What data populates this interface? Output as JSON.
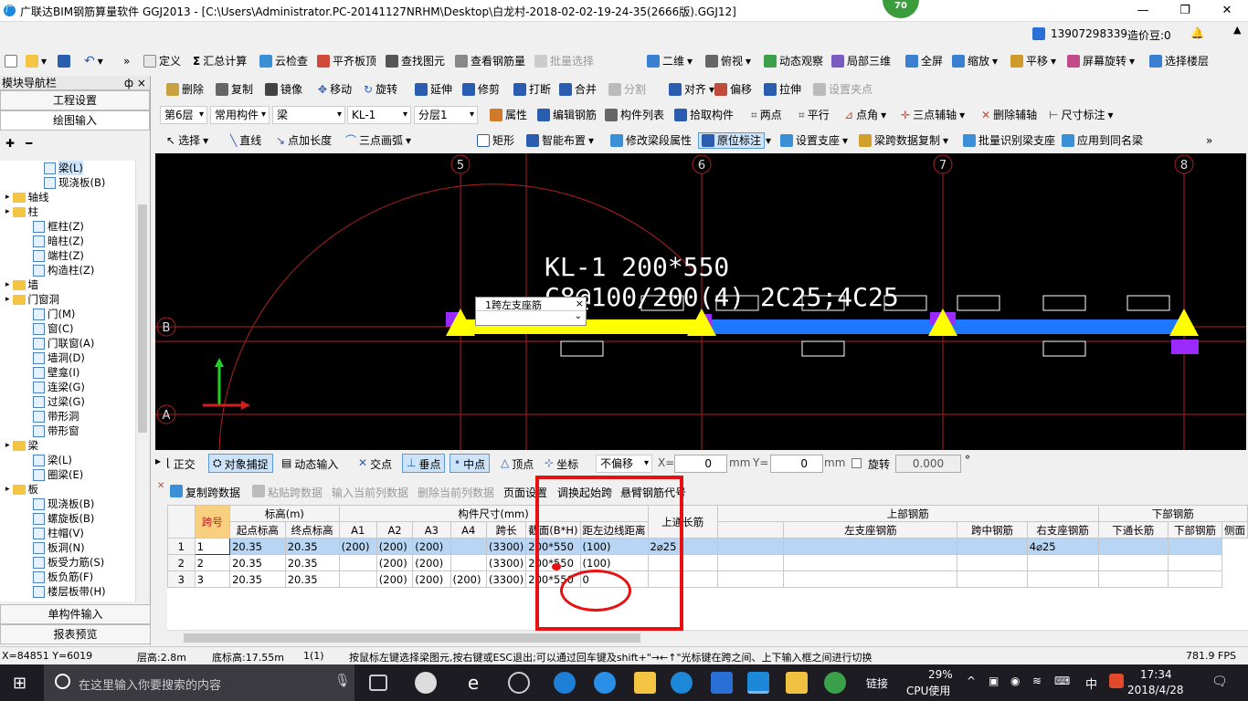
{
  "window": {
    "title": "广联达BIM钢筋算量软件 GGJ2013 - [C:\\Users\\Administrator.PC-20141127NRHM\\Desktop\\白龙村-2018-02-02-19-24-35(2666版).GGJ12]",
    "badge": "70"
  },
  "userbar": {
    "phone": "13907298339",
    "coins": "造价豆:0"
  },
  "toolbar1": {
    "items": [
      "定义",
      "汇总计算",
      "云检查",
      "平齐板顶",
      "查找图元",
      "查看钢筋量",
      "批量选择",
      "二维",
      "俯视",
      "动态观察",
      "局部三维",
      "全屏",
      "缩放",
      "平移",
      "屏幕旋转",
      "选择楼层"
    ]
  },
  "toolbar2": {
    "items": [
      "删除",
      "复制",
      "镜像",
      "移动",
      "旋转",
      "延伸",
      "修剪",
      "打断",
      "合并",
      "分割",
      "对齐",
      "偏移",
      "拉伸",
      "设置夹点"
    ]
  },
  "toolbar3": {
    "floor": "第6层",
    "category": "常用构件",
    "type": "梁",
    "name": "KL-1",
    "layer": "分层1",
    "items": [
      "属性",
      "编辑钢筋",
      "构件列表",
      "拾取构件",
      "两点",
      "平行",
      "点角",
      "三点辅轴",
      "删除辅轴",
      "尺寸标注"
    ]
  },
  "toolbar4": {
    "items": [
      "选择",
      "直线",
      "点加长度",
      "三点画弧",
      "矩形",
      "智能布置",
      "修改梁段属性",
      "原位标注",
      "设置支座",
      "梁跨数据复制",
      "批量识别梁支座",
      "应用到同名梁"
    ]
  },
  "nav": {
    "title": "模块导航栏",
    "pin": "ф ×",
    "btn_project": "工程设置",
    "btn_draw": "绘图输入",
    "btn_single": "单构件输入",
    "btn_report": "报表预览",
    "tree": [
      "梁(L)",
      "现浇板(B)",
      "轴线",
      "柱",
      "框柱(Z)",
      "暗柱(Z)",
      "端柱(Z)",
      "构造柱(Z)",
      "墙",
      "门窗洞",
      "门(M)",
      "窗(C)",
      "门联窗(A)",
      "墙洞(D)",
      "壁龛(I)",
      "连梁(G)",
      "过梁(G)",
      "带形洞",
      "带形窗",
      "梁",
      "梁(L)",
      "圈梁(E)",
      "板",
      "现浇板(B)",
      "螺旋板(B)",
      "柱帽(V)",
      "板洞(N)",
      "板受力筋(S)",
      "板负筋(F)",
      "楼层板带(H)"
    ]
  },
  "canvas": {
    "axes": [
      "5",
      "6",
      "7",
      "8"
    ],
    "rows": [
      "B",
      "A"
    ],
    "label1": "KL-1 200*550",
    "label2": "C8@100/200(4) 2C25;4C25",
    "popup": "1跨左支座筋",
    "popup_close": "×"
  },
  "snapbar": {
    "items": [
      "正交",
      "对象捕捉",
      "动态输入",
      "交点",
      "垂点",
      "中点",
      "顶点",
      "坐标",
      "不偏移"
    ],
    "x_label": "X=",
    "x_val": "0",
    "mm1": "mm",
    "y_label": "Y=",
    "y_val": "0",
    "mm2": "mm",
    "rotate": "旋转",
    "rot_val": "0.000",
    "deg": "°"
  },
  "tblbar": {
    "items": [
      "复制跨数据",
      "粘贴跨数据",
      "输入当前列数据",
      "删除当前列数据",
      "页面设置",
      "调换起始跨",
      "悬臂钢筋代号"
    ]
  },
  "grid": {
    "group1": [
      "跨号",
      "标高(m)",
      "构件尺寸(mm)",
      "上通长筋",
      "上部钢筋",
      "下部钢筋"
    ],
    "cols": [
      "起点标高",
      "终点标高",
      "A1",
      "A2",
      "A3",
      "A4",
      "跨长",
      "截面(B*H)",
      "距左边线距离",
      "左支座钢筋",
      "跨中钢筋",
      "右支座钢筋",
      "下通长筋",
      "下部钢筋",
      "侧面"
    ],
    "rows": [
      {
        "n": "1",
        "span": "1",
        "s": "20.35",
        "e": "20.35",
        "a1": "(200)",
        "a2": "(200)",
        "a3": "(200)",
        "a4": "",
        "len": "(3300)",
        "sec": "200*550",
        "dist": "(100)",
        "top": "2⌀25",
        "bot": "4⌀25"
      },
      {
        "n": "2",
        "span": "2",
        "s": "20.35",
        "e": "20.35",
        "a1": "",
        "a2": "(200)",
        "a3": "(200)",
        "a4": "",
        "len": "(3300)",
        "sec": "200*550",
        "dist": "(100)",
        "top": "",
        "bot": ""
      },
      {
        "n": "3",
        "span": "3",
        "s": "20.35",
        "e": "20.35",
        "a1": "",
        "a2": "(200)",
        "a3": "(200)",
        "a4": "(200)",
        "len": "(3300)",
        "sec": "200*550",
        "dist": "0",
        "top": "",
        "bot": ""
      }
    ]
  },
  "status": {
    "coords": "X=84851 Y=6019",
    "floor_h": "层高:2.8m",
    "base_h": "底标高:17.55m",
    "count": "1(1)",
    "hint": "按鼠标左键选择梁图元,按右键或ESC退出;可以通过回车键及shift+\"→←↑\"光标键在跨之间、上下输入框之间进行切换",
    "fps": "781.9 FPS"
  },
  "taskbar": {
    "search": "在这里输入你要搜索的内容",
    "link": "链接",
    "cpu": "29%",
    "cpu_label": "CPU使用",
    "ime": "中",
    "time": "17:34",
    "date": "2018/4/28"
  }
}
